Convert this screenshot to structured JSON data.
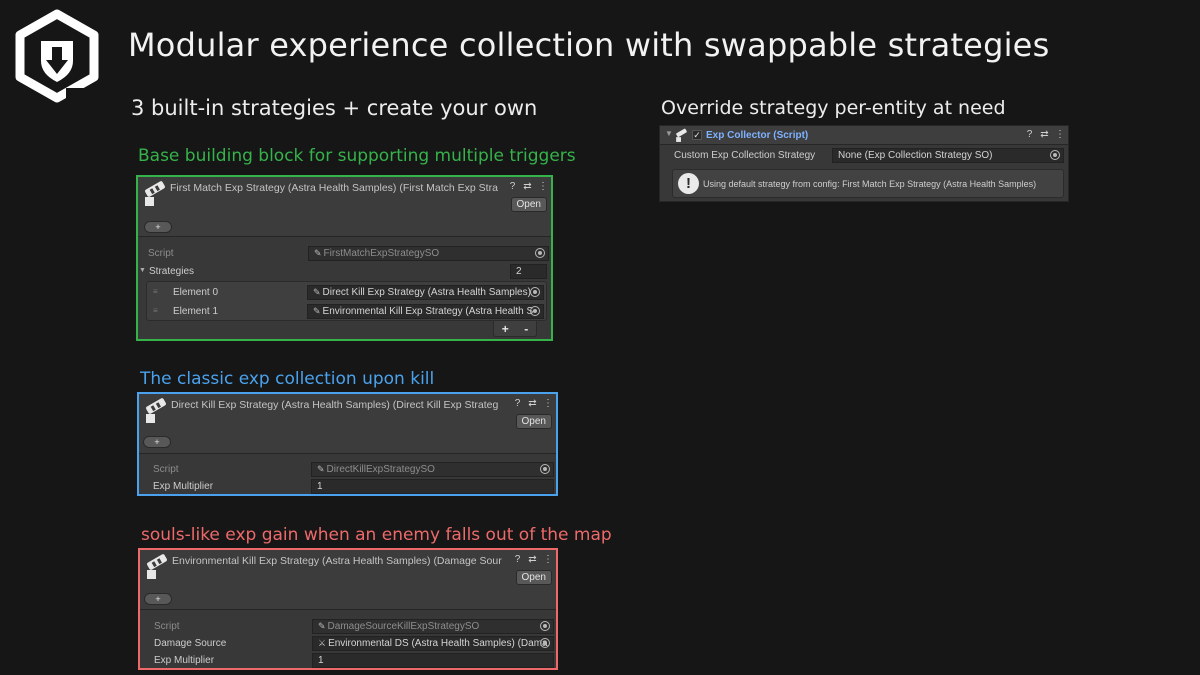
{
  "header": {
    "title": "Modular experience collection with swappable strategies",
    "subtitle_left": "3 built-in strategies + create your own",
    "subtitle_right": "Override strategy per-entity at need"
  },
  "colors": {
    "green": "#36b24a",
    "blue": "#4aa2ee",
    "red": "#ee6a6a",
    "link_blue": "#7fb1ff"
  },
  "panels": {
    "first_match": {
      "caption": "Base building block for supporting multiple triggers",
      "title": "First Match Exp Strategy (Astra Health Samples) (First Match Exp Stra",
      "open_label": "Open",
      "plus_label": "+",
      "script_label": "Script",
      "script_value": "FirstMatchExpStrategySO",
      "strategies_label": "Strategies",
      "strategies_count": "2",
      "elements": [
        {
          "label": "Element 0",
          "value": "Direct Kill Exp Strategy (Astra Health Samples)"
        },
        {
          "label": "Element 1",
          "value": "Environmental Kill Exp Strategy (Astra Health S"
        }
      ],
      "add_label": "+",
      "remove_label": "-"
    },
    "direct_kill": {
      "caption": "The classic exp collection upon kill",
      "title": "Direct Kill Exp Strategy (Astra Health Samples) (Direct Kill Exp Strateg",
      "open_label": "Open",
      "plus_label": "+",
      "script_label": "Script",
      "script_value": "DirectKillExpStrategySO",
      "multiplier_label": "Exp Multiplier",
      "multiplier_value": "1"
    },
    "environmental": {
      "caption": "souls-like exp gain when an enemy falls out of the map",
      "title": "Environmental Kill Exp Strategy (Astra Health Samples) (Damage Sour",
      "open_label": "Open",
      "plus_label": "+",
      "script_label": "Script",
      "script_value": "DamageSourceKillExpStrategySO",
      "damage_source_label": "Damage Source",
      "damage_source_value": "Environmental DS (Astra Health Samples) (Dama",
      "multiplier_label": "Exp Multiplier",
      "multiplier_value": "1"
    }
  },
  "exp_collector": {
    "title": "Exp Collector (Script)",
    "field_label": "Custom Exp Collection Strategy",
    "field_value": "None (Exp Collection Strategy SO)",
    "help_text": "Using default strategy from config: First Match Exp Strategy (Astra Health Samples)"
  },
  "icons": {
    "help": "?",
    "presets": "⇄",
    "menu": "⋮",
    "script": "✎",
    "warning": "!",
    "check": "✓",
    "fold": "▼"
  }
}
